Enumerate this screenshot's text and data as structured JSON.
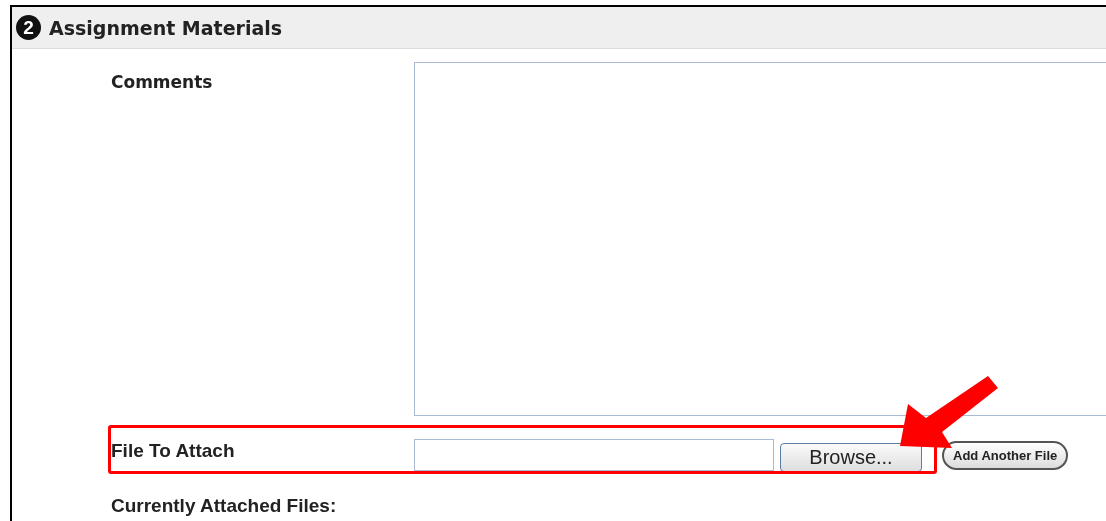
{
  "section": {
    "step": "2",
    "title": "Assignment Materials"
  },
  "comments": {
    "label": "Comments"
  },
  "file_to_attach": {
    "label": "File To Attach",
    "browse_button": "Browse...",
    "add_button": "Add Another File"
  },
  "attached_files": {
    "label": "Currently Attached Files:"
  }
}
